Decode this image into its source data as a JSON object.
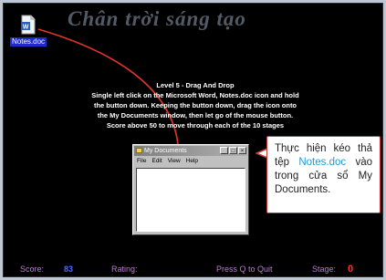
{
  "watermark": "Chân trời sáng tạo",
  "desktop_icon": {
    "label": "Notes.doc",
    "icon": "word-document-icon"
  },
  "instructions": {
    "title": "Level 5 - Drag And Drop",
    "line1": "Single left click on the Microsoft Word, Notes.doc icon and hold",
    "line2": "the button down. Keeping the button down, drag the icon onto",
    "line3": "the My Documents window, then let go of the mouse button.",
    "line4": "Score above 50 to move through each of the 10 stages"
  },
  "window": {
    "title": "My Documents",
    "menu": [
      "File",
      "Edit",
      "View",
      "Help"
    ],
    "buttons": {
      "minimize": "_",
      "maximize": "□",
      "close": "×"
    }
  },
  "callout": {
    "before": "Thực hiện kéo thả tệp ",
    "highlight": "Notes.doc",
    "after": " vào trong cửa sổ My Documents."
  },
  "status": {
    "score_label": "Score:",
    "score_value": "83",
    "rating_label": "Rating:",
    "quit_text": "Press Q to Quit",
    "stage_label": "Stage:",
    "stage_value": "0"
  },
  "colors": {
    "background": "#000000",
    "label_purple": "#b97ad6",
    "score_blue": "#4a6cff",
    "stage_red": "#ff2e2e",
    "arrow_red": "#e0352a",
    "callout_border": "#c83a3a",
    "highlight_blue": "#1e9bd7"
  }
}
